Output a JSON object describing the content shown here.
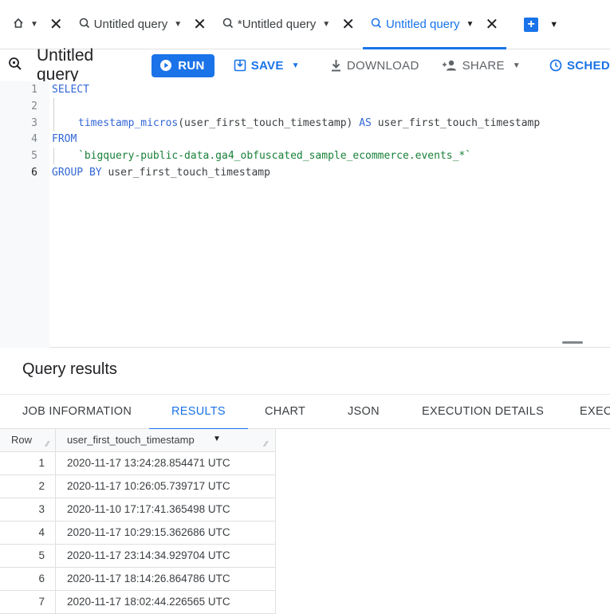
{
  "tabs": [
    {
      "label": "",
      "icon": "home-icon"
    },
    {
      "label": "Untitled query",
      "icon": "query-icon"
    },
    {
      "label": "*Untitled query",
      "icon": "query-icon"
    },
    {
      "label": "Untitled query",
      "icon": "query-icon",
      "active": true
    }
  ],
  "toolbar": {
    "title": "Untitled query",
    "run_label": "RUN",
    "save_label": "SAVE",
    "download_label": "DOWNLOAD",
    "share_label": "SHARE",
    "schedule_label": "SCHED"
  },
  "editor": {
    "line_numbers": [
      "1",
      "2",
      "3",
      "4",
      "5",
      "6"
    ],
    "lines": {
      "l1_kw": "SELECT",
      "l3_fn": "timestamp_micros",
      "l3_arg": "(user_first_touch_timestamp)",
      "l3_as": "AS",
      "l3_alias": "user_first_touch_timestamp",
      "l4_kw": "FROM",
      "l5_str": "`bigquery-public-data.ga4_obfuscated_sample_ecommerce.events_*`",
      "l6_kw": "GROUP BY",
      "l6_rest": "user_first_touch_timestamp"
    }
  },
  "results": {
    "title": "Query results",
    "tabs": [
      "JOB INFORMATION",
      "RESULTS",
      "CHART",
      "JSON",
      "EXECUTION DETAILS",
      "EXECU"
    ],
    "active_tab": "RESULTS",
    "columns": {
      "row": "Row",
      "col1": "user_first_touch_timestamp"
    },
    "rows": [
      {
        "n": "1",
        "v": "2020-11-17 13:24:28.854471 UTC"
      },
      {
        "n": "2",
        "v": "2020-11-17 10:26:05.739717 UTC"
      },
      {
        "n": "3",
        "v": "2020-11-10 17:17:41.365498 UTC"
      },
      {
        "n": "4",
        "v": "2020-11-17 10:29:15.362686 UTC"
      },
      {
        "n": "5",
        "v": "2020-11-17 23:14:34.929704 UTC"
      },
      {
        "n": "6",
        "v": "2020-11-17 18:14:26.864786 UTC"
      },
      {
        "n": "7",
        "v": "2020-11-17 18:02:44.226565 UTC"
      }
    ]
  },
  "colors": {
    "accent": "#1a73e8",
    "keyword": "#3367d6",
    "string": "#188038"
  }
}
